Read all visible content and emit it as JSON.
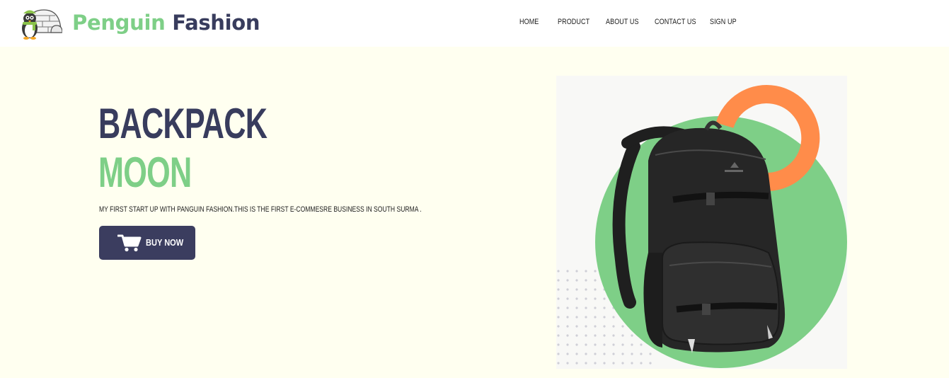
{
  "header": {
    "logo_word1": "Penguin",
    "logo_word2": "Fashion",
    "logo_icon": "penguin-igloo-icon"
  },
  "nav": {
    "items": [
      "HOME",
      "PRODUCT",
      "ABOUT US",
      "CONTACT US",
      "SIGN UP"
    ]
  },
  "hero": {
    "title_line1": "BACKPACK",
    "title_line2": "MOON",
    "description": "MY FIRST START UP WITH PANGUIN FASHION.THIS IS THE FIRST E-COMMESRE BUSINESS IN SOUTH SURMA .",
    "button_label": "BUY NOW",
    "button_icon": "shopping-cart-icon"
  },
  "colors": {
    "brand_dark": "#383c5d",
    "brand_green": "#7ecf87",
    "accent_orange": "#ff8c4a",
    "hero_background": "#fffff0"
  }
}
